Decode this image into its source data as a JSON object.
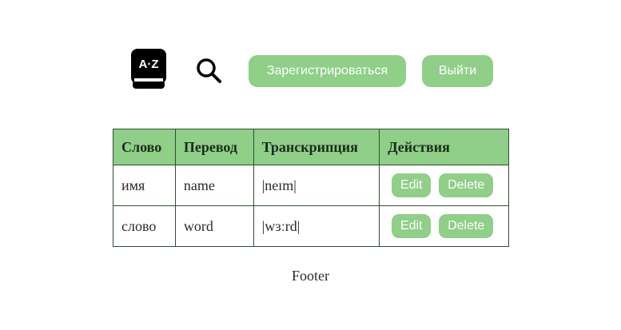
{
  "header": {
    "logo_text": "A·Z",
    "register_label": "Зарегистрироваться",
    "logout_label": "Выйти"
  },
  "table": {
    "headers": [
      "Слово",
      "Перевод",
      "Транскрипция",
      "Действия"
    ],
    "rows": [
      {
        "word": "имя",
        "translation": "name",
        "transcription": "|neɪm|",
        "edit_label": "Edit",
        "delete_label": "Delete"
      },
      {
        "word": "слово",
        "translation": "word",
        "transcription": "|wɜːrd|",
        "edit_label": "Edit",
        "delete_label": "Delete"
      }
    ]
  },
  "footer": {
    "text": "Footer"
  },
  "colors": {
    "accent": "#8fcf88",
    "border": "#2f4f2f"
  }
}
